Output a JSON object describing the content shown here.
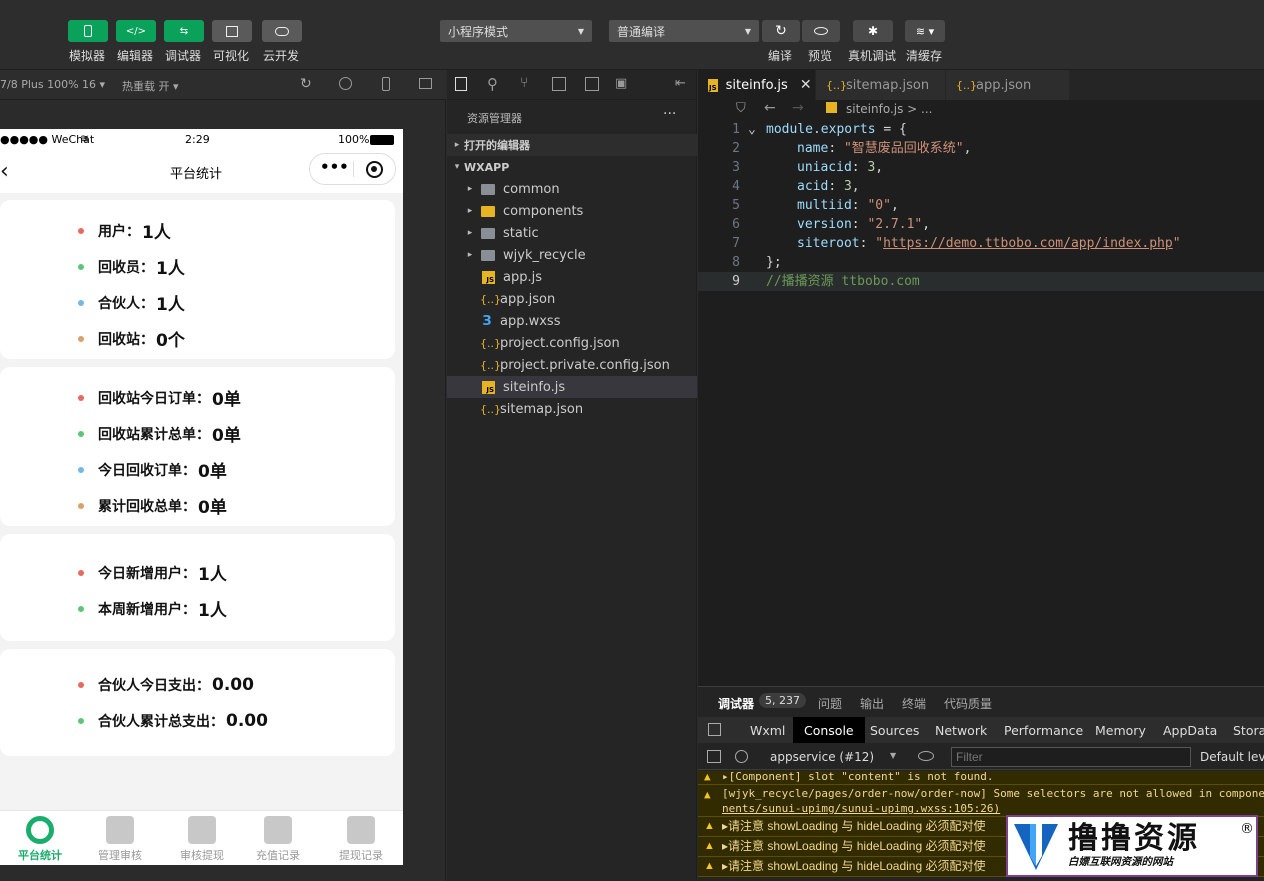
{
  "toolbar": {
    "buttons": [
      {
        "label": "模拟器",
        "icon": "phone-icon"
      },
      {
        "label": "编辑器",
        "icon": "code-icon"
      },
      {
        "label": "调试器",
        "icon": "debug-toggle-icon"
      },
      {
        "label": "可视化",
        "icon": "layout-icon"
      },
      {
        "label": "云开发",
        "icon": "cloud-icon"
      }
    ],
    "mode_select": "小程序模式",
    "compile_select": "普通编译",
    "actions": [
      {
        "label": "编译",
        "icon": "refresh-icon"
      },
      {
        "label": "预览",
        "icon": "eye-icon"
      },
      {
        "label": "真机调试",
        "icon": "bug-icon"
      },
      {
        "label": "清缓存",
        "icon": "layers-icon"
      }
    ]
  },
  "simbar": {
    "device": "7/8 Plus 100% 16 ▾",
    "hotreload": "热重载 开 ▾"
  },
  "phone": {
    "status": {
      "carrier": "●●●●● WeChat",
      "time": "2:29",
      "battery": "100%"
    },
    "nav_title": "平台统计",
    "cards": [
      {
        "items": [
          {
            "label": "用户：",
            "value": "1人",
            "color": "#e8695f"
          },
          {
            "label": "回收员：",
            "value": "1人",
            "color": "#5dc577"
          },
          {
            "label": "合伙人：",
            "value": "1人",
            "color": "#72b7e5"
          },
          {
            "label": "回收站：",
            "value": "0个",
            "color": "#d9a26b"
          }
        ]
      },
      {
        "items": [
          {
            "label": "回收站今日订单：",
            "value": "0单",
            "color": "#e8695f"
          },
          {
            "label": "回收站累计总单：",
            "value": "0单",
            "color": "#5dc577"
          },
          {
            "label": "今日回收订单：",
            "value": "0单",
            "color": "#72b7e5"
          },
          {
            "label": "累计回收总单：",
            "value": "0单",
            "color": "#d9a26b"
          }
        ]
      },
      {
        "items": [
          {
            "label": "今日新增用户：",
            "value": "1人",
            "color": "#e8695f"
          },
          {
            "label": "本周新增用户：",
            "value": "1人",
            "color": "#5dc577"
          }
        ]
      },
      {
        "items": [
          {
            "label": "合伙人今日支出：",
            "value": "0.00",
            "color": "#e8695f"
          },
          {
            "label": "合伙人累计总支出：",
            "value": "0.00",
            "color": "#5dc577"
          }
        ]
      }
    ],
    "tabs": [
      {
        "label": "平台统计",
        "active": true
      },
      {
        "label": "管理审核"
      },
      {
        "label": "审核提现"
      },
      {
        "label": "充值记录"
      },
      {
        "label": "提现记录"
      }
    ]
  },
  "explorer": {
    "title": "资源管理器",
    "more": "···",
    "open_editors": "打开的编辑器",
    "root": "WXAPP",
    "items": [
      {
        "name": "common",
        "type": "folder"
      },
      {
        "name": "components",
        "type": "folder"
      },
      {
        "name": "static",
        "type": "folder"
      },
      {
        "name": "wjyk_recycle",
        "type": "folder"
      },
      {
        "name": "app.js",
        "type": "js"
      },
      {
        "name": "app.json",
        "type": "json"
      },
      {
        "name": "app.wxss",
        "type": "wxss"
      },
      {
        "name": "project.config.json",
        "type": "json"
      },
      {
        "name": "project.private.config.json",
        "type": "json"
      },
      {
        "name": "siteinfo.js",
        "type": "js",
        "selected": true
      },
      {
        "name": "sitemap.json",
        "type": "json"
      }
    ]
  },
  "editor": {
    "tabs": [
      {
        "name": "siteinfo.js",
        "active": true
      },
      {
        "name": "sitemap.json"
      },
      {
        "name": "app.json"
      }
    ],
    "breadcrumb": "siteinfo.js > ...",
    "code": {
      "l1a": "module.exports",
      "l1b": " = {",
      "l2k": "name",
      "l2v": "\"智慧废品回收系统\"",
      "l3k": "uniacid",
      "l3v": "3",
      "l4k": "acid",
      "l4v": "3",
      "l5k": "multiid",
      "l5v": "\"0\"",
      "l6k": "version",
      "l6v": "\"2.7.1\"",
      "l7k": "siteroot",
      "l7v": "https://demo.ttbobo.com/app/index.php",
      "l8": "};",
      "l9": "//播播资源 ttbobo.com"
    }
  },
  "debug": {
    "tabs": [
      "调试器",
      "问题",
      "输出",
      "终端",
      "代码质量"
    ],
    "badge": "5, 237",
    "devtools_tabs": [
      "Wxml",
      "Console",
      "Sources",
      "Network",
      "Performance",
      "Memory",
      "AppData",
      "Storag"
    ],
    "context": "appservice (#12)",
    "filter_placeholder": "Filter",
    "levels": "Default leve",
    "logs": [
      "▸[Component] slot \"content\" is not found.",
      "[wjyk_recycle/pages/order-now/order-now] Some selectors are not allowed in compone",
      "nents/sunui-upimg/sunui-upimg.wxss:105:26)",
      "▸请注意 showLoading 与 hideLoading 必须配对使",
      "▸请注意 showLoading 与 hideLoading 必须配对使",
      "▸请注意 showLoading 与 hideLoading 必须配对使"
    ]
  },
  "watermark": {
    "title": "撸撸资源",
    "subtitle": "白嫖互联网资源的网站",
    "reg": "®"
  }
}
